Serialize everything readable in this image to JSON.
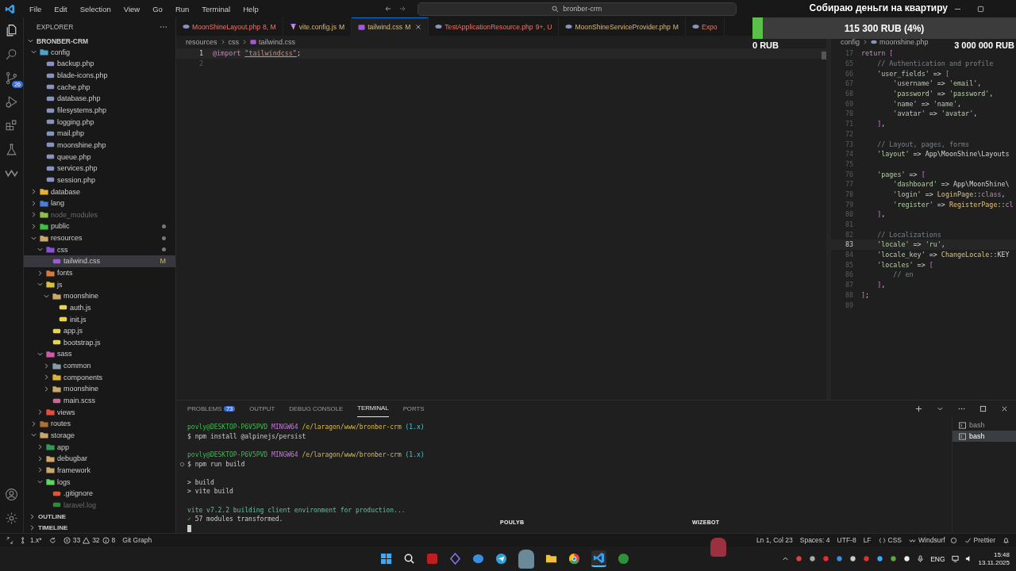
{
  "menu": [
    "File",
    "Edit",
    "Selection",
    "View",
    "Go",
    "Run",
    "Terminal",
    "Help"
  ],
  "command_center": "bronber-crm",
  "donation": {
    "title": "Собираю деньги на квартиру",
    "progress_label": "115 300 RUB (4%)",
    "level": 0.04,
    "min_label": "0 RUB",
    "max_label": "3 000 000 RUB"
  },
  "activity_bar": {
    "source_control_badge": "26"
  },
  "explorer": {
    "title": "EXPLORER",
    "project": "BRONBER-CRM",
    "tree": [
      {
        "label": "config",
        "kind": "folder",
        "color": "#4fa3c8",
        "expanded": true,
        "selected": false,
        "dimmed": false,
        "dot": false,
        "children": [
          {
            "label": "backup.php",
            "kind": "php",
            "selected": false,
            "dimmed": false,
            "dot": false
          },
          {
            "label": "blade-icons.php",
            "kind": "php",
            "selected": false,
            "dimmed": false,
            "dot": false
          },
          {
            "label": "cache.php",
            "kind": "php",
            "selected": false,
            "dimmed": false,
            "dot": false
          },
          {
            "label": "database.php",
            "kind": "php",
            "selected": false,
            "dimmed": false,
            "dot": false
          },
          {
            "label": "filesystems.php",
            "kind": "php",
            "selected": false,
            "dimmed": false,
            "dot": false
          },
          {
            "label": "logging.php",
            "kind": "php",
            "selected": false,
            "dimmed": false,
            "dot": false
          },
          {
            "label": "mail.php",
            "kind": "php",
            "selected": false,
            "dimmed": false,
            "dot": false
          },
          {
            "label": "moonshine.php",
            "kind": "php",
            "selected": false,
            "dimmed": false,
            "dot": false
          },
          {
            "label": "queue.php",
            "kind": "php",
            "selected": false,
            "dimmed": false,
            "dot": false
          },
          {
            "label": "services.php",
            "kind": "php",
            "selected": false,
            "dimmed": false,
            "dot": false
          },
          {
            "label": "session.php",
            "kind": "php",
            "selected": false,
            "dimmed": false,
            "dot": false
          }
        ]
      },
      {
        "label": "database",
        "kind": "folder",
        "color": "#e0b23a",
        "expanded": false,
        "selected": false,
        "dimmed": false,
        "dot": false
      },
      {
        "label": "lang",
        "kind": "folder",
        "color": "#4a7fd4",
        "expanded": false,
        "selected": false,
        "dimmed": false,
        "dot": false
      },
      {
        "label": "node_modules",
        "kind": "folder",
        "color": "#8bc34a",
        "expanded": false,
        "selected": false,
        "dimmed": true,
        "dot": false
      },
      {
        "label": "public",
        "kind": "folder",
        "color": "#3fbf3f",
        "expanded": false,
        "selected": false,
        "dimmed": false,
        "dot": true
      },
      {
        "label": "resources",
        "kind": "folder",
        "color": "#c9a86b",
        "expanded": true,
        "selected": false,
        "dimmed": false,
        "dot": true,
        "children": [
          {
            "label": "css",
            "kind": "folder",
            "color": "#8a4fd8",
            "expanded": true,
            "selected": false,
            "dimmed": false,
            "dot": true,
            "children": [
              {
                "label": "tailwind.css",
                "kind": "css",
                "selected": true,
                "dimmed": false,
                "dot": false,
                "status": "M"
              }
            ]
          },
          {
            "label": "fonts",
            "kind": "folder",
            "color": "#d87a3c",
            "expanded": false,
            "selected": false,
            "dimmed": false,
            "dot": false
          },
          {
            "label": "js",
            "kind": "folder",
            "color": "#d8c040",
            "expanded": true,
            "selected": false,
            "dimmed": false,
            "dot": false,
            "children": [
              {
                "label": "moonshine",
                "kind": "folder",
                "color": "#c9a86b",
                "expanded": true,
                "selected": false,
                "dimmed": false,
                "dot": false,
                "children": [
                  {
                    "label": "auth.js",
                    "kind": "js",
                    "selected": false,
                    "dimmed": false,
                    "dot": false
                  },
                  {
                    "label": "init.js",
                    "kind": "js",
                    "selected": false,
                    "dimmed": false,
                    "dot": false
                  }
                ]
              },
              {
                "label": "app.js",
                "kind": "js",
                "selected": false,
                "dimmed": false,
                "dot": false
              },
              {
                "label": "bootstrap.js",
                "kind": "js",
                "selected": false,
                "dimmed": false,
                "dot": false
              }
            ]
          },
          {
            "label": "sass",
            "kind": "folder",
            "color": "#d05aa8",
            "expanded": true,
            "selected": false,
            "dimmed": false,
            "dot": false,
            "children": [
              {
                "label": "common",
                "kind": "folder",
                "color": "#8a9ba8",
                "expanded": false,
                "selected": false,
                "dimmed": false,
                "dot": false
              },
              {
                "label": "components",
                "kind": "folder",
                "color": "#e0b23a",
                "expanded": false,
                "selected": false,
                "dimmed": false,
                "dot": false
              },
              {
                "label": "moonshine",
                "kind": "folder",
                "color": "#c9a86b",
                "expanded": false,
                "selected": false,
                "dimmed": false,
                "dot": false
              },
              {
                "label": "main.scss",
                "kind": "scss",
                "selected": false,
                "dimmed": false,
                "dot": false
              }
            ]
          },
          {
            "label": "views",
            "kind": "folder",
            "color": "#e05040",
            "expanded": false,
            "selected": false,
            "dimmed": false,
            "dot": false
          }
        ]
      },
      {
        "label": "routes",
        "kind": "folder",
        "color": "#b07030",
        "expanded": false,
        "selected": false,
        "dimmed": false,
        "dot": false
      },
      {
        "label": "storage",
        "kind": "folder",
        "color": "#c9a86b",
        "expanded": true,
        "selected": false,
        "dimmed": false,
        "dot": false,
        "children": [
          {
            "label": "app",
            "kind": "folder",
            "color": "#2f9a5a",
            "expanded": false,
            "selected": false,
            "dimmed": false,
            "dot": false
          },
          {
            "label": "debugbar",
            "kind": "folder",
            "color": "#c9a86b",
            "expanded": false,
            "selected": false,
            "dimmed": false,
            "dot": false
          },
          {
            "label": "framework",
            "kind": "folder",
            "color": "#c9a86b",
            "expanded": false,
            "selected": false,
            "dimmed": false,
            "dot": false
          },
          {
            "label": "logs",
            "kind": "folder",
            "color": "#5ed35e",
            "expanded": true,
            "selected": false,
            "dimmed": false,
            "dot": false,
            "children": [
              {
                "label": ".gitignore",
                "kind": "git",
                "selected": false,
                "dimmed": false,
                "dot": false
              },
              {
                "label": "laravel.log",
                "kind": "log",
                "selected": false,
                "dimmed": true,
                "dot": false
              }
            ]
          }
        ]
      }
    ],
    "sections": [
      "OUTLINE",
      "TIMELINE"
    ]
  },
  "tabs": [
    {
      "label": "MoonShineLayout.php",
      "badge": "8, M",
      "kind": "php",
      "problem": true,
      "selected": false
    },
    {
      "label": "vite.config.js",
      "badge": "M",
      "kind": "vite",
      "problem": false,
      "selected": false
    },
    {
      "label": "tailwind.css",
      "badge": "M",
      "kind": "css",
      "problem": false,
      "selected": true
    },
    {
      "label": "TestApplicationResource.php",
      "badge": "9+, U",
      "kind": "php",
      "problem": true,
      "selected": false
    },
    {
      "label": "MoonShineServiceProvider.php",
      "badge": "M",
      "kind": "php",
      "problem": false,
      "selected": false
    },
    {
      "label": "Expo",
      "kind": "php",
      "problem": true,
      "selected": false
    }
  ],
  "editor": {
    "breadcrumb": [
      "resources",
      "css",
      "tailwind.css"
    ],
    "lines": [
      {
        "n": "1",
        "current": true,
        "tokens": [
          {
            "text": "@import ",
            "kind": "keyword"
          },
          {
            "text": "\"tailwindcss\"",
            "kind": "link"
          },
          {
            "text": ";",
            "kind": "plain"
          }
        ]
      },
      {
        "n": "2",
        "current": false
      }
    ]
  },
  "side_editor": {
    "breadcrumb": [
      "config",
      "moonshine.php"
    ],
    "lines": [
      {
        "n": "17",
        "current": false,
        "tokens": [
          {
            "text": "return",
            "kind": "keyword"
          },
          {
            "text": " [",
            "kind": "bracket"
          }
        ]
      },
      {
        "n": "65",
        "current": false,
        "tokens": [
          {
            "text": "    // Authentication and profile",
            "kind": "comment"
          }
        ]
      },
      {
        "n": "66",
        "current": false,
        "tokens": [
          {
            "text": "    'user_fields'",
            "kind": "string"
          },
          {
            "text": " => ",
            "kind": "plain"
          },
          {
            "text": "[",
            "kind": "bracket"
          }
        ]
      },
      {
        "n": "67",
        "current": false,
        "tokens": [
          {
            "text": "        'username'",
            "kind": "string"
          },
          {
            "text": " => ",
            "kind": "plain"
          },
          {
            "text": "'email'",
            "kind": "string"
          },
          {
            "text": ",",
            "kind": "plain"
          }
        ]
      },
      {
        "n": "68",
        "current": false,
        "tokens": [
          {
            "text": "        'password'",
            "kind": "string"
          },
          {
            "text": " => ",
            "kind": "plain"
          },
          {
            "text": "'password'",
            "kind": "string"
          },
          {
            "text": ",",
            "kind": "plain"
          }
        ]
      },
      {
        "n": "69",
        "current": false,
        "tokens": [
          {
            "text": "        'name'",
            "kind": "string"
          },
          {
            "text": " => ",
            "kind": "plain"
          },
          {
            "text": "'name'",
            "kind": "string"
          },
          {
            "text": ",",
            "kind": "plain"
          }
        ]
      },
      {
        "n": "70",
        "current": false,
        "tokens": [
          {
            "text": "        'avatar'",
            "kind": "string"
          },
          {
            "text": " => ",
            "kind": "plain"
          },
          {
            "text": "'avatar'",
            "kind": "string"
          },
          {
            "text": ",",
            "kind": "plain"
          }
        ]
      },
      {
        "n": "71",
        "current": false,
        "tokens": [
          {
            "text": "    ]",
            "kind": "bracket"
          },
          {
            "text": ",",
            "kind": "plain"
          }
        ]
      },
      {
        "n": "72",
        "current": false
      },
      {
        "n": "73",
        "current": false,
        "tokens": [
          {
            "text": "    // Layout, pages, forms",
            "kind": "comment"
          }
        ]
      },
      {
        "n": "74",
        "current": false,
        "tokens": [
          {
            "text": "    'layout'",
            "kind": "string"
          },
          {
            "text": " => App\\MoonShine\\Layouts",
            "kind": "plain"
          }
        ]
      },
      {
        "n": "75",
        "current": false
      },
      {
        "n": "76",
        "current": false,
        "tokens": [
          {
            "text": "    'pages'",
            "kind": "string"
          },
          {
            "text": " => ",
            "kind": "plain"
          },
          {
            "text": "[",
            "kind": "bracket"
          }
        ]
      },
      {
        "n": "77",
        "current": false,
        "tokens": [
          {
            "text": "        'dashboard'",
            "kind": "string"
          },
          {
            "text": " => App\\MoonShine\\",
            "kind": "plain"
          }
        ]
      },
      {
        "n": "78",
        "current": false,
        "tokens": [
          {
            "text": "        'login'",
            "kind": "string"
          },
          {
            "text": " => ",
            "kind": "plain"
          },
          {
            "text": "LoginPage",
            "kind": "class"
          },
          {
            "text": "::",
            "kind": "plain"
          },
          {
            "text": "class",
            "kind": "keyword"
          },
          {
            "text": ",",
            "kind": "plain"
          }
        ]
      },
      {
        "n": "79",
        "current": false,
        "tokens": [
          {
            "text": "        'register'",
            "kind": "string"
          },
          {
            "text": " => ",
            "kind": "plain"
          },
          {
            "text": "RegisterPage",
            "kind": "class"
          },
          {
            "text": "::",
            "kind": "plain"
          },
          {
            "text": "cl",
            "kind": "keyword"
          }
        ]
      },
      {
        "n": "80",
        "current": false,
        "tokens": [
          {
            "text": "    ]",
            "kind": "bracket"
          },
          {
            "text": ",",
            "kind": "plain"
          }
        ]
      },
      {
        "n": "81",
        "current": false
      },
      {
        "n": "82",
        "current": false,
        "tokens": [
          {
            "text": "    // Localizations",
            "kind": "comment"
          }
        ]
      },
      {
        "n": "83",
        "current": true,
        "tokens": [
          {
            "text": "    'locale'",
            "kind": "string"
          },
          {
            "text": " => ",
            "kind": "plain"
          },
          {
            "text": "'ru'",
            "kind": "string"
          },
          {
            "text": ",",
            "kind": "plain"
          }
        ]
      },
      {
        "n": "84",
        "current": false,
        "tokens": [
          {
            "text": "    'locale_key'",
            "kind": "string"
          },
          {
            "text": " => ",
            "kind": "plain"
          },
          {
            "text": "ChangeLocale",
            "kind": "class"
          },
          {
            "text": "::KEY",
            "kind": "plain"
          }
        ]
      },
      {
        "n": "85",
        "current": false,
        "tokens": [
          {
            "text": "    'locales'",
            "kind": "string"
          },
          {
            "text": " => ",
            "kind": "plain"
          },
          {
            "text": "[",
            "kind": "bracket"
          }
        ]
      },
      {
        "n": "86",
        "current": false,
        "tokens": [
          {
            "text": "        // en",
            "kind": "comment"
          }
        ]
      },
      {
        "n": "87",
        "current": false,
        "tokens": [
          {
            "text": "    ]",
            "kind": "bracket"
          },
          {
            "text": ",",
            "kind": "plain"
          }
        ]
      },
      {
        "n": "88",
        "current": false,
        "tokens": [
          {
            "text": "]",
            "kind": "bracket"
          },
          {
            "text": ";",
            "kind": "plain"
          }
        ]
      },
      {
        "n": "89",
        "current": false
      }
    ]
  },
  "panel": {
    "tabs": [
      {
        "label": "PROBLEMS",
        "badge": "73",
        "selected": false
      },
      {
        "label": "OUTPUT",
        "selected": false
      },
      {
        "label": "DEBUG CONSOLE",
        "selected": false
      },
      {
        "label": "TERMINAL",
        "selected": true
      },
      {
        "label": "PORTS",
        "selected": false
      }
    ],
    "terminal_lines": [
      {
        "marker": false,
        "segs": [
          {
            "text": "povly@DESKTOP-P6V5PVD",
            "kind": "user"
          },
          {
            "text": " MINGW64",
            "kind": "host"
          },
          {
            "text": " /e/laragon/www/bronber-crm",
            "kind": "path"
          },
          {
            "text": " (1.x)",
            "kind": "branch"
          }
        ]
      },
      {
        "marker": false,
        "segs": [
          {
            "text": "$ npm install @alpinejs/persist",
            "kind": "plain"
          }
        ]
      },
      {
        "marker": false
      },
      {
        "marker": false,
        "segs": [
          {
            "text": "povly@DESKTOP-P6V5PVD",
            "kind": "user"
          },
          {
            "text": " MINGW64",
            "kind": "host"
          },
          {
            "text": " /e/laragon/www/bronber-crm",
            "kind": "path"
          },
          {
            "text": " (1.x)",
            "kind": "branch"
          }
        ]
      },
      {
        "marker": true,
        "segs": [
          {
            "text": "$ npm run build",
            "kind": "plain"
          }
        ]
      },
      {
        "marker": false
      },
      {
        "marker": false,
        "segs": [
          {
            "text": "> build",
            "kind": "plain"
          }
        ]
      },
      {
        "marker": false,
        "segs": [
          {
            "text": "> vite build",
            "kind": "plain"
          }
        ]
      },
      {
        "marker": false
      },
      {
        "marker": false,
        "segs": [
          {
            "text": "vite v7.2.2 building client environment for production...",
            "kind": "success"
          }
        ]
      },
      {
        "marker": false,
        "segs": [
          {
            "text": "✓",
            "kind": "check"
          },
          {
            "text": " 57 modules transformed.",
            "kind": "plain"
          }
        ]
      },
      {
        "marker": false,
        "cursor": true
      }
    ],
    "terminals": [
      {
        "label": "bash",
        "selected": false
      },
      {
        "label": "bash",
        "selected": true
      }
    ]
  },
  "stream_overlay": {
    "names": [
      "POULYB",
      "WIZEBOT"
    ]
  },
  "status_bar": {
    "branch": "1.x*",
    "errors": "33",
    "warnings": "32",
    "infos": "8",
    "git_graph": "Git Graph",
    "right": [
      {
        "label": "Ln 1, Col 23",
        "kind": "text"
      },
      {
        "label": "Spaces: 4",
        "kind": "text"
      },
      {
        "label": "UTF-8",
        "kind": "text"
      },
      {
        "label": "LF",
        "kind": "text"
      },
      {
        "label": "CSS",
        "kind": "language"
      },
      {
        "label": "Windsurf",
        "kind": "windsurf"
      },
      {
        "label": "Prettier",
        "kind": "prettier"
      }
    ]
  },
  "taskbar": {
    "language": "ENG",
    "time": "15:48",
    "date": "13.11.2025"
  }
}
